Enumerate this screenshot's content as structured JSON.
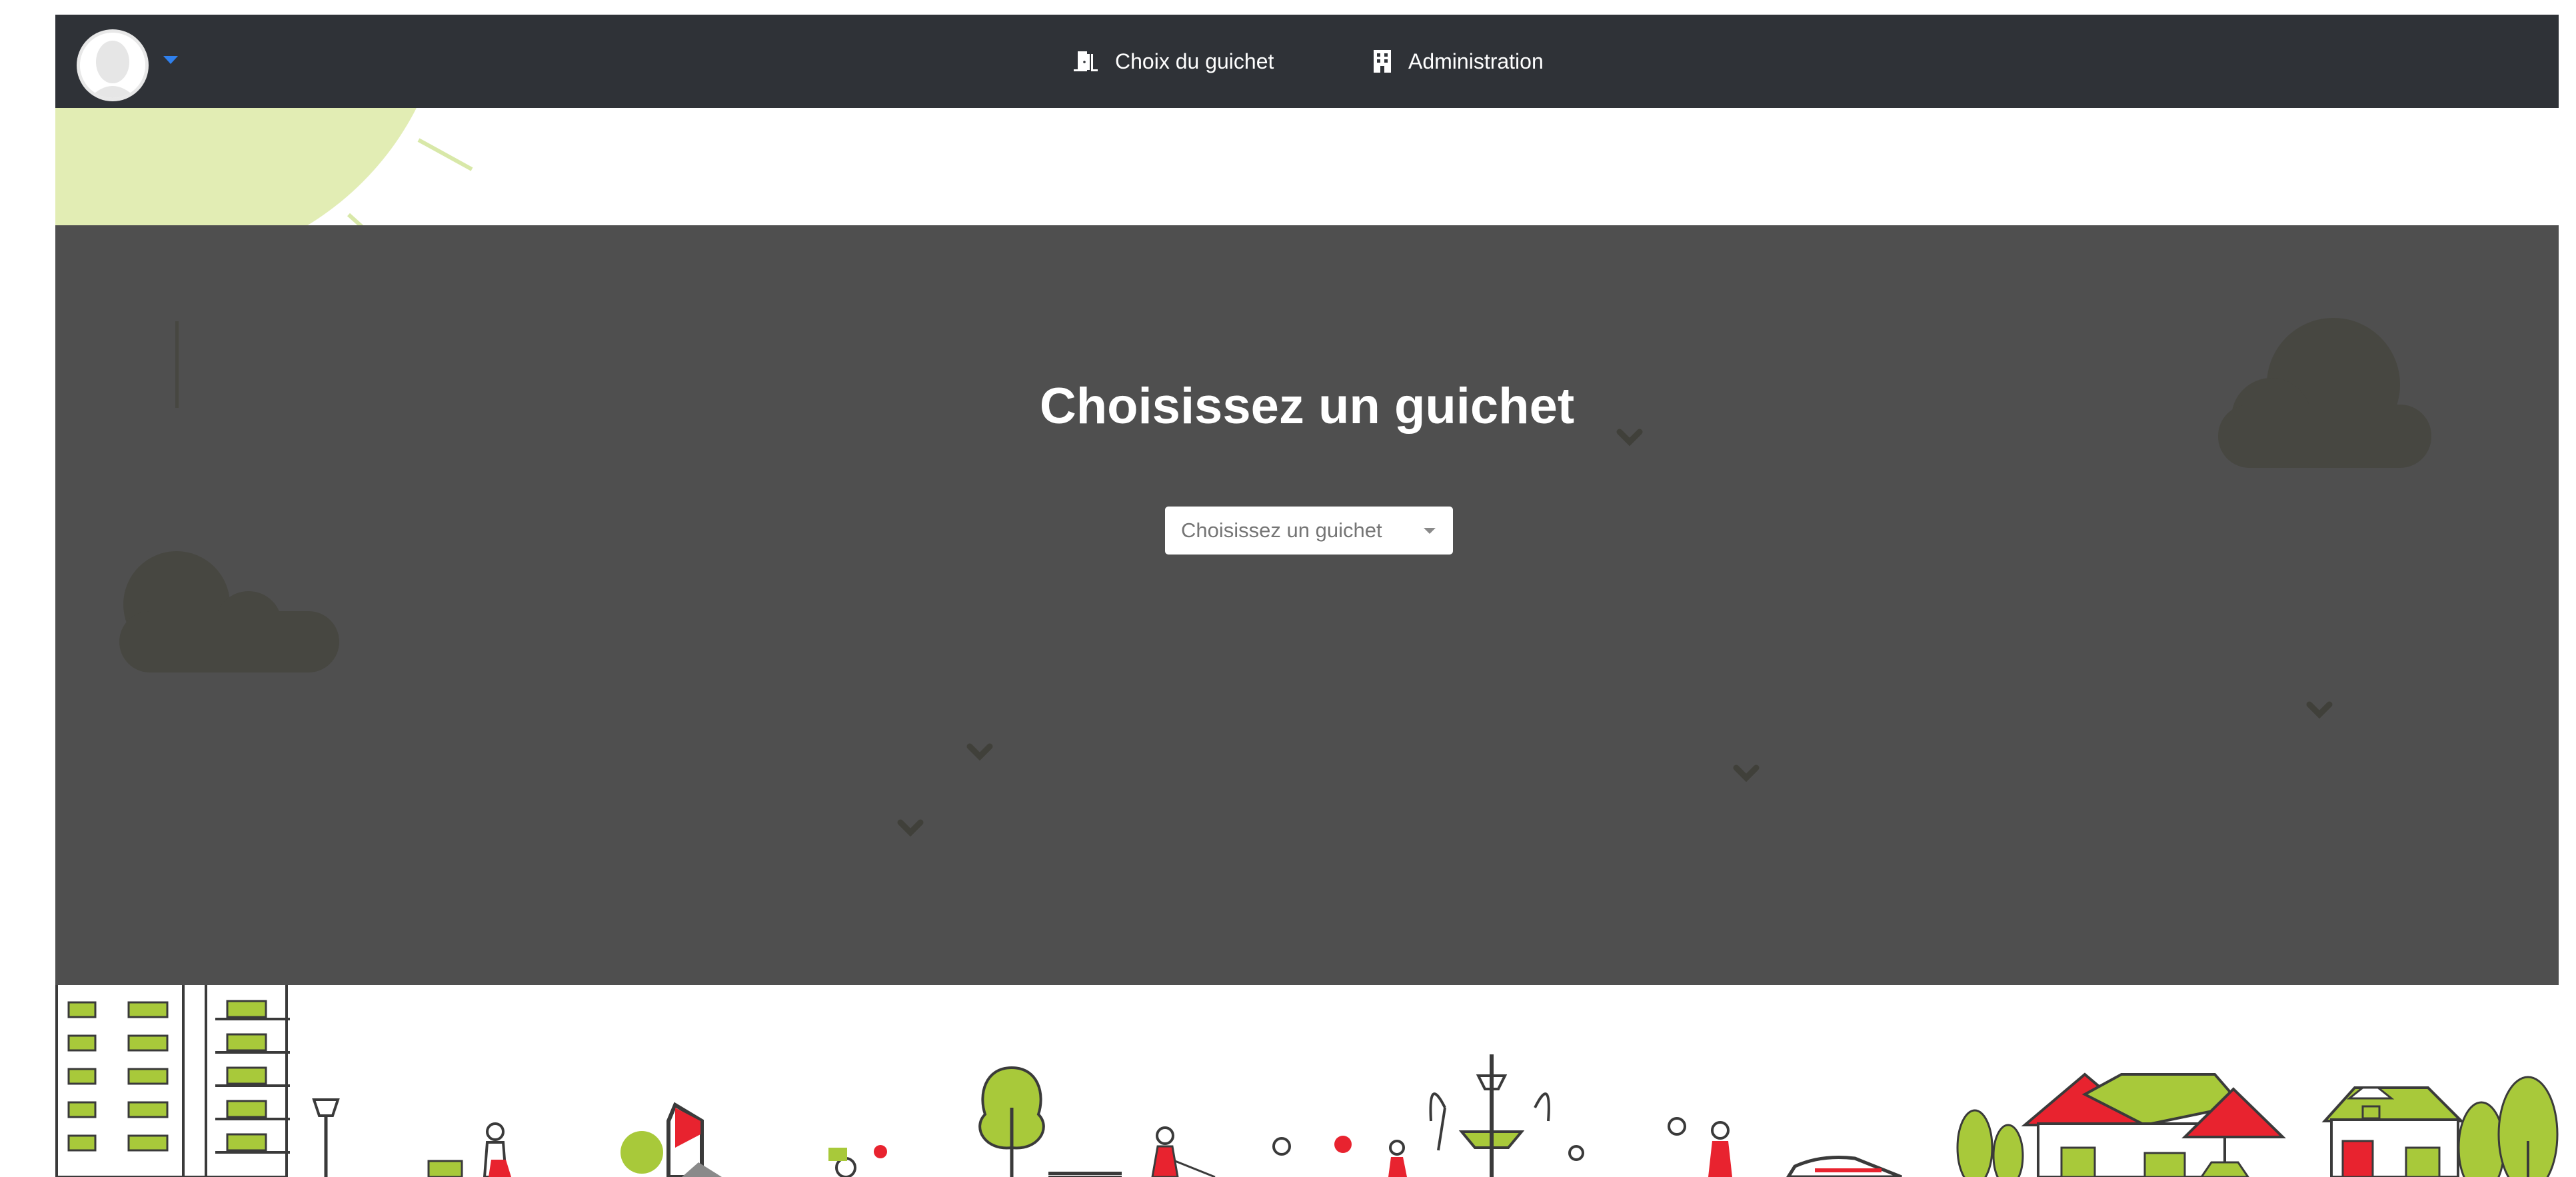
{
  "navbar": {
    "avatar_icon": "user-avatar-icon",
    "links": [
      {
        "label": "Choix du guichet",
        "icon": "door-icon"
      },
      {
        "label": "Administration",
        "icon": "building-icon"
      }
    ]
  },
  "hero": {
    "title": "Choisissez un guichet",
    "select": {
      "selected_text": "Choisissez un guichet"
    }
  },
  "colors": {
    "navbar_bg": "#2f3237",
    "hero_overlay": "#4f4f4f",
    "accent_green": "#a8c93a",
    "accent_red": "#e8232f",
    "caret_blue": "#2f80ed"
  }
}
